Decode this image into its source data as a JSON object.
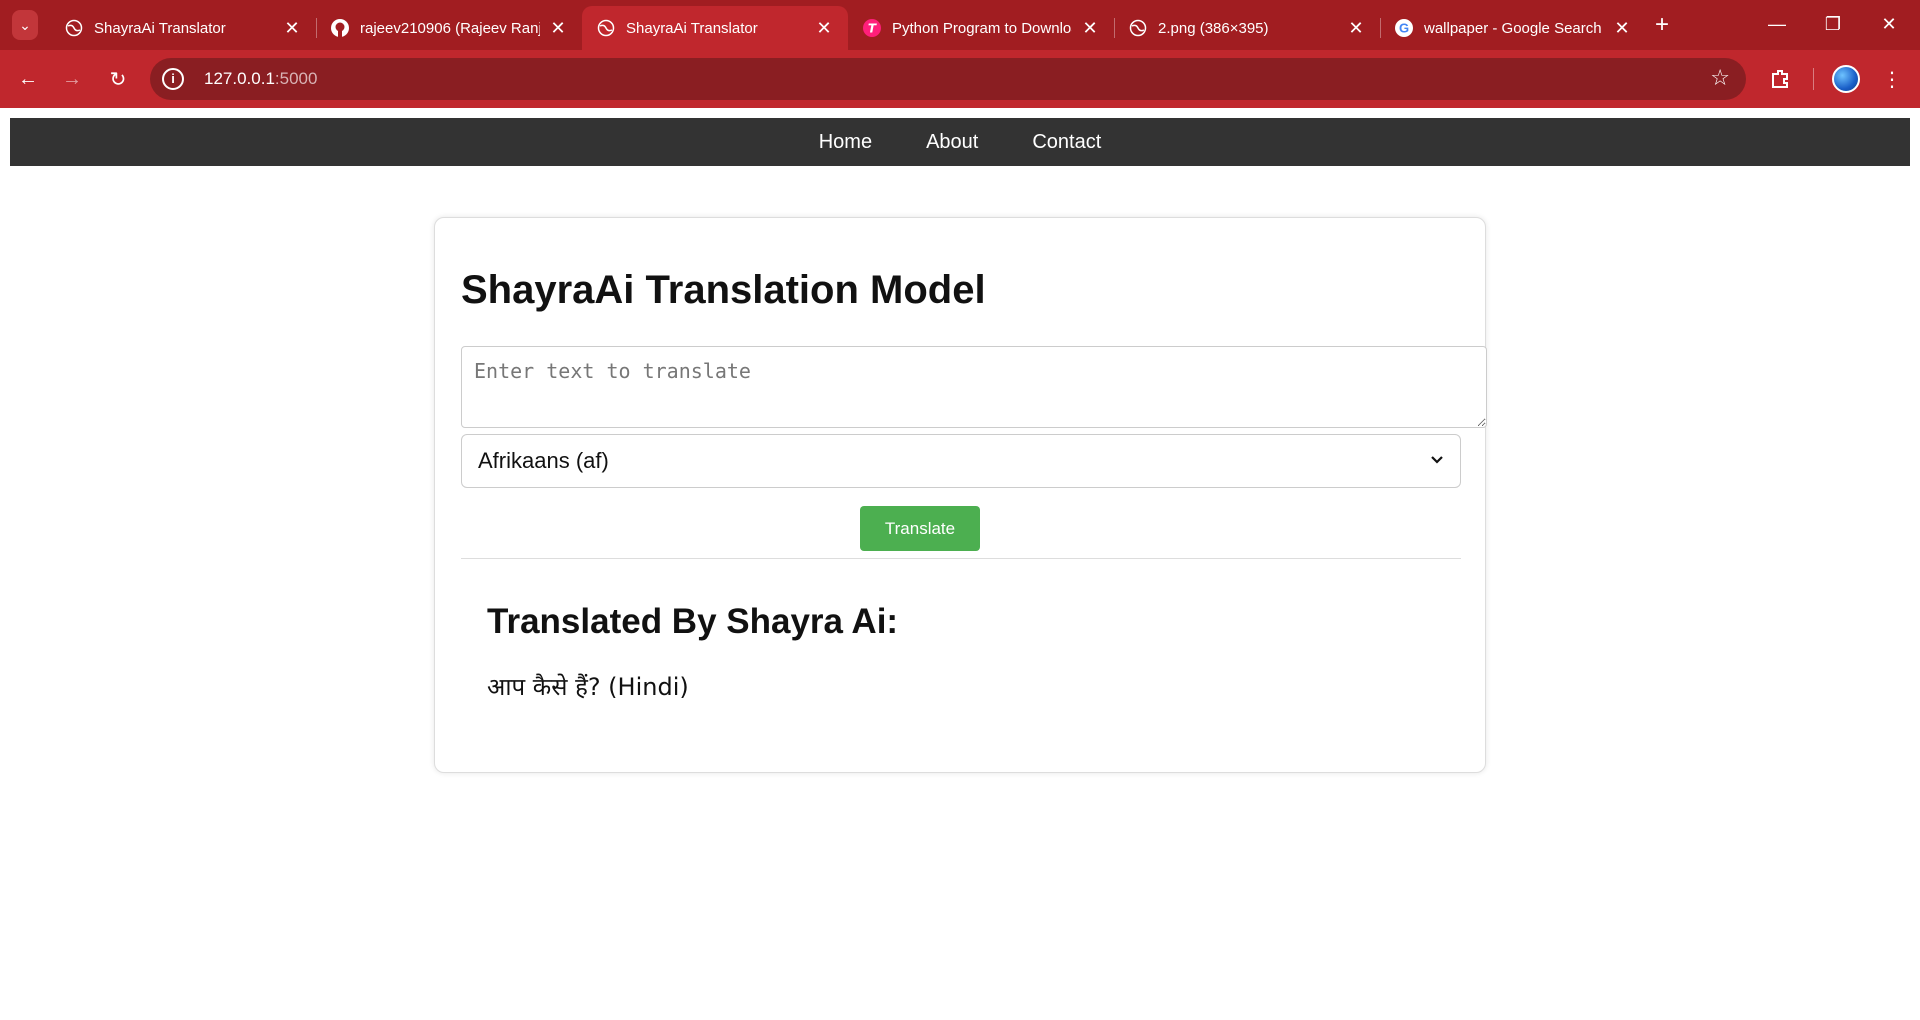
{
  "browser": {
    "tabs": [
      {
        "title": "ShayraAi Translator",
        "icon": "globe-icon",
        "active": false
      },
      {
        "title": "rajeev210906 (Rajeev Ranjan)",
        "icon": "github-icon",
        "active": false
      },
      {
        "title": "ShayraAi Translator",
        "icon": "globe-icon",
        "active": true
      },
      {
        "title": "Python Program to Download",
        "icon": "pink-t-icon",
        "active": false
      },
      {
        "title": "2.png (386×395)",
        "icon": "globe-icon",
        "active": false
      },
      {
        "title": "wallpaper - Google Search",
        "icon": "google-icon",
        "active": false
      }
    ],
    "address": {
      "host": "127.0.0.1",
      "port": ":5000"
    },
    "colors": {
      "tabstrip": "#a11d21",
      "toolbar": "#c0272d",
      "omnibox": "#8a1e22"
    }
  },
  "nav": {
    "items": [
      "Home",
      "About",
      "Contact"
    ],
    "background": "#333333"
  },
  "main": {
    "title": "ShayraAi Translation Model",
    "input": {
      "placeholder": "Enter text to translate",
      "value": ""
    },
    "language_select": {
      "selected": "Afrikaans (af)"
    },
    "translate_button": "Translate",
    "result_heading": "Translated By Shayra Ai:",
    "result_text": "आप कैसे हैं? (Hindi)",
    "accent": "#4caf50"
  }
}
